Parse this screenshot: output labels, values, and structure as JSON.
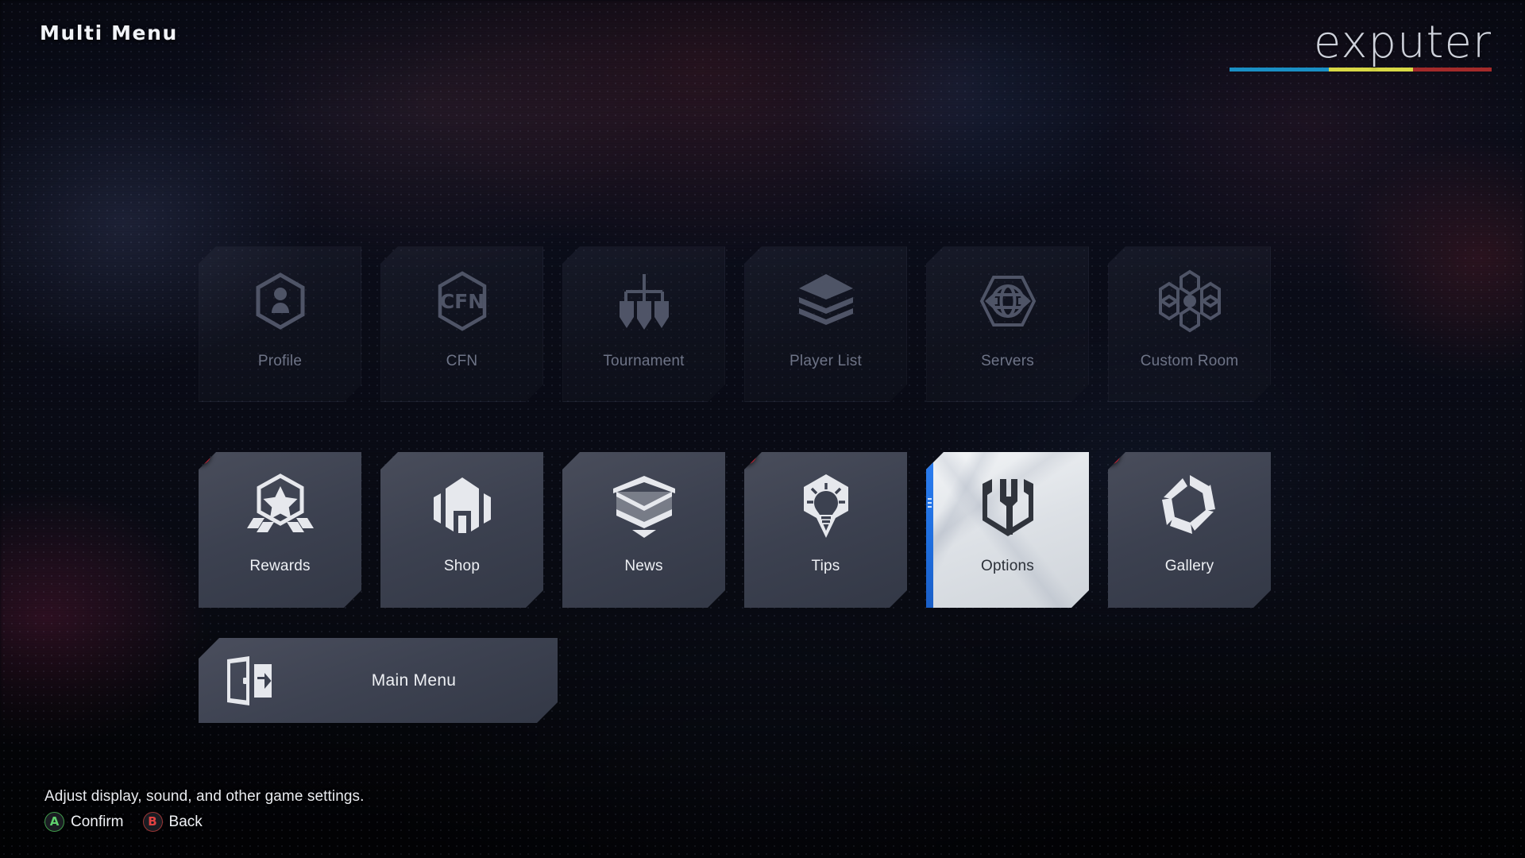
{
  "header": {
    "title": "Multi Menu",
    "watermark_text": "exputer",
    "watermark_colors": [
      "#1a8fc4",
      "#d8d845",
      "#a32a2a"
    ]
  },
  "colors": {
    "selection_accent": "#1f6fe0",
    "badge_red": "#e02030",
    "confirm_green": "#5fd06d",
    "back_red": "#e04242",
    "tile_active_bg": "#3c4150",
    "tile_selected_bg": "#e4e8ec"
  },
  "grid": {
    "rows": [
      {
        "state": "disabled",
        "tiles": [
          {
            "label": "Profile",
            "icon": "profile-hexagon-icon",
            "badge": false
          },
          {
            "label": "CFN",
            "icon": "cfn-hexagon-icon",
            "badge": false
          },
          {
            "label": "Tournament",
            "icon": "tournament-bracket-icon",
            "badge": false
          },
          {
            "label": "Player List",
            "icon": "stacked-layers-icon",
            "badge": false
          },
          {
            "label": "Servers",
            "icon": "globe-network-icon",
            "badge": false
          },
          {
            "label": "Custom Room",
            "icon": "hexagon-cluster-icon",
            "badge": false
          }
        ]
      },
      {
        "state": "active",
        "tiles": [
          {
            "label": "Rewards",
            "icon": "star-badge-icon",
            "badge": true,
            "selected": false
          },
          {
            "label": "Shop",
            "icon": "storefront-icon",
            "badge": false,
            "selected": false
          },
          {
            "label": "News",
            "icon": "envelope-icon",
            "badge": false,
            "selected": false
          },
          {
            "label": "Tips",
            "icon": "lightbulb-icon",
            "badge": true,
            "selected": false
          },
          {
            "label": "Options",
            "icon": "wrench-icon",
            "badge": false,
            "selected": true
          },
          {
            "label": "Gallery",
            "icon": "camera-shutter-icon",
            "badge": true,
            "selected": false
          }
        ]
      }
    ]
  },
  "main_menu_button": {
    "label": "Main Menu",
    "icon": "exit-door-icon"
  },
  "footer": {
    "description": "Adjust display, sound, and other game settings.",
    "prompts": [
      {
        "button": "A",
        "label": "Confirm"
      },
      {
        "button": "B",
        "label": "Back"
      }
    ]
  }
}
